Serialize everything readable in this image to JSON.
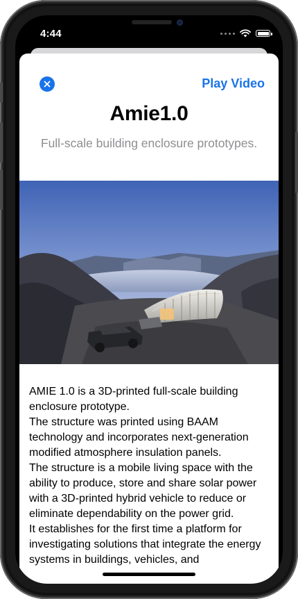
{
  "status_bar": {
    "time": "4:44",
    "icons": [
      "cellular-signal-icon",
      "wifi-icon",
      "battery-icon"
    ]
  },
  "header": {
    "close_icon": "close-icon",
    "play_video_label": "Play Video"
  },
  "title": "Amie1.0",
  "subtitle": "Full-scale building enclosure prototypes.",
  "hero_image": {
    "subject": "3D-printed arched structure and vehicle on a rocky hillside above a lake at dusk"
  },
  "description": {
    "paragraphs": [
      "AMIE 1.0 is a 3D-printed full-scale building enclosure prototype.",
      "The structure was printed using BAAM technology and incorporates next-generation modified atmosphere insulation panels.",
      "The structure is a mobile living space with the ability to produce, store and share solar power with a 3D-printed hybrid vehicle to reduce or eliminate dependability on the power grid.",
      "It establishes for the first time a platform for investigating solutions that integrate the energy systems in buildings, vehicles, and"
    ]
  },
  "colors": {
    "accent": "#1a73e8",
    "subtitle_text": "#8e8e93",
    "frame": "#1a1a1a"
  }
}
